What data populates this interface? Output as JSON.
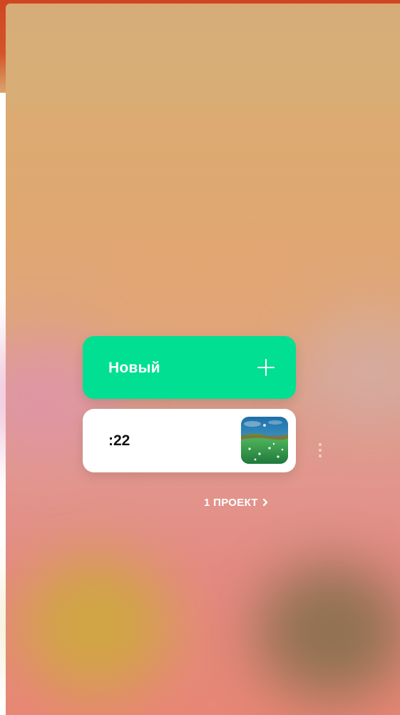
{
  "new_project": {
    "label": "Новый",
    "icon": "plus-icon"
  },
  "recent_project": {
    "name": ":22",
    "thumbnail": "grass-landscape-thumbnail",
    "menu_icon": "more-vertical-icon"
  },
  "projects_link": {
    "label": "1 ПРОЕКТ",
    "icon": "chevron-right-icon"
  },
  "colors": {
    "accent_green": "#00df92",
    "card_white": "#ffffff",
    "label_dark": "#111111"
  }
}
